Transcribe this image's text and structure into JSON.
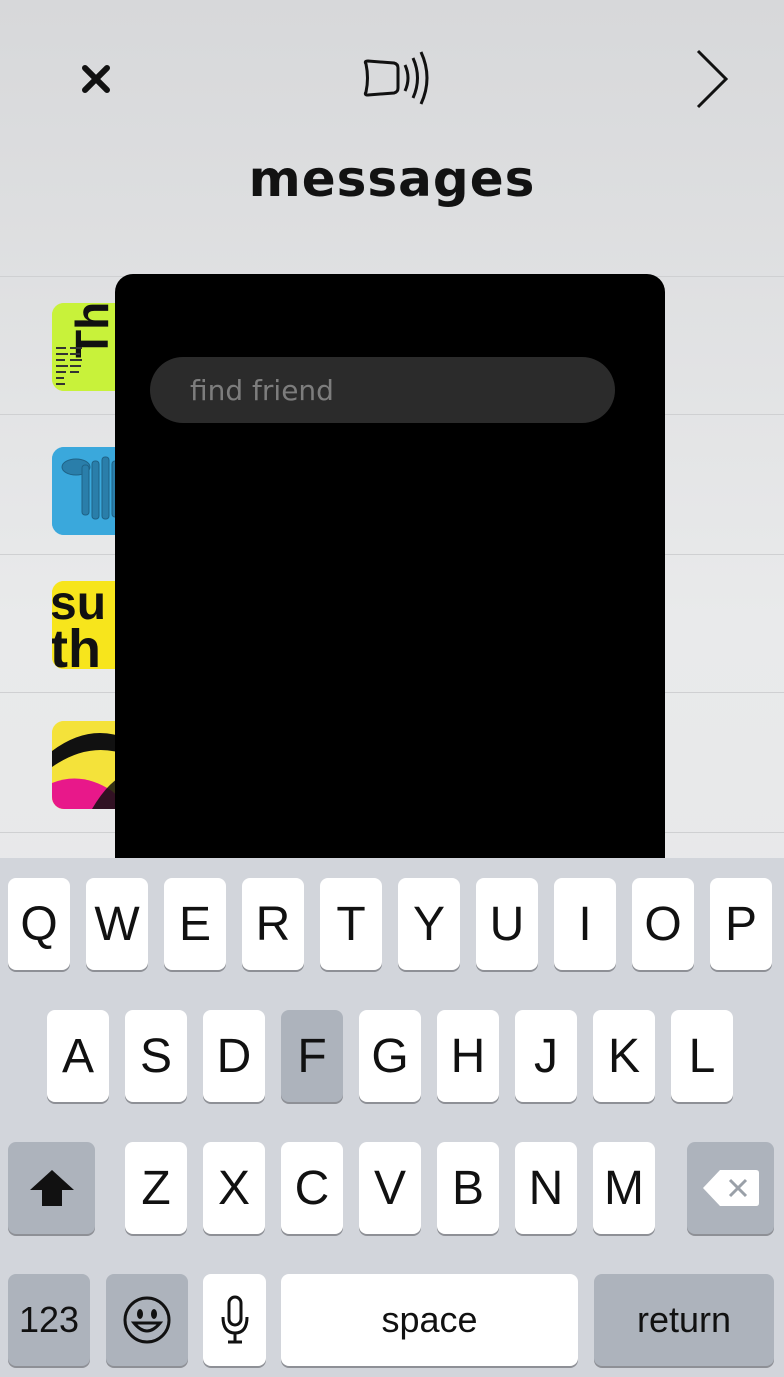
{
  "header": {
    "title": "messages",
    "close_icon": "close-icon",
    "speaker_icon": "speaker-wave-icon",
    "next_icon": "chevron-right-icon"
  },
  "conversations": [
    {
      "thumbnail": "green-poster-thumbnail",
      "accent": "#c8f23a"
    },
    {
      "thumbnail": "blue-poster-thumbnail",
      "accent": "#3aa8dc"
    },
    {
      "thumbnail": "yellow-type-thumbnail",
      "accent": "#f7e51c"
    },
    {
      "thumbnail": "yellow-magenta-thumbnail",
      "accent": "#f4e23a"
    }
  ],
  "search": {
    "placeholder": "find friend",
    "value": ""
  },
  "keyboard": {
    "row1": [
      "Q",
      "W",
      "E",
      "R",
      "T",
      "Y",
      "U",
      "I",
      "O",
      "P"
    ],
    "row2": [
      "A",
      "S",
      "D",
      "F",
      "G",
      "H",
      "J",
      "K",
      "L"
    ],
    "row3": [
      "Z",
      "X",
      "C",
      "V",
      "B",
      "N",
      "M"
    ],
    "highlighted_key": "F",
    "numbers_label": "123",
    "space_label": "space",
    "return_label": "return",
    "shift_icon": "shift-icon",
    "delete_icon": "delete-icon",
    "emoji_icon": "emoji-icon",
    "mic_icon": "microphone-icon"
  }
}
